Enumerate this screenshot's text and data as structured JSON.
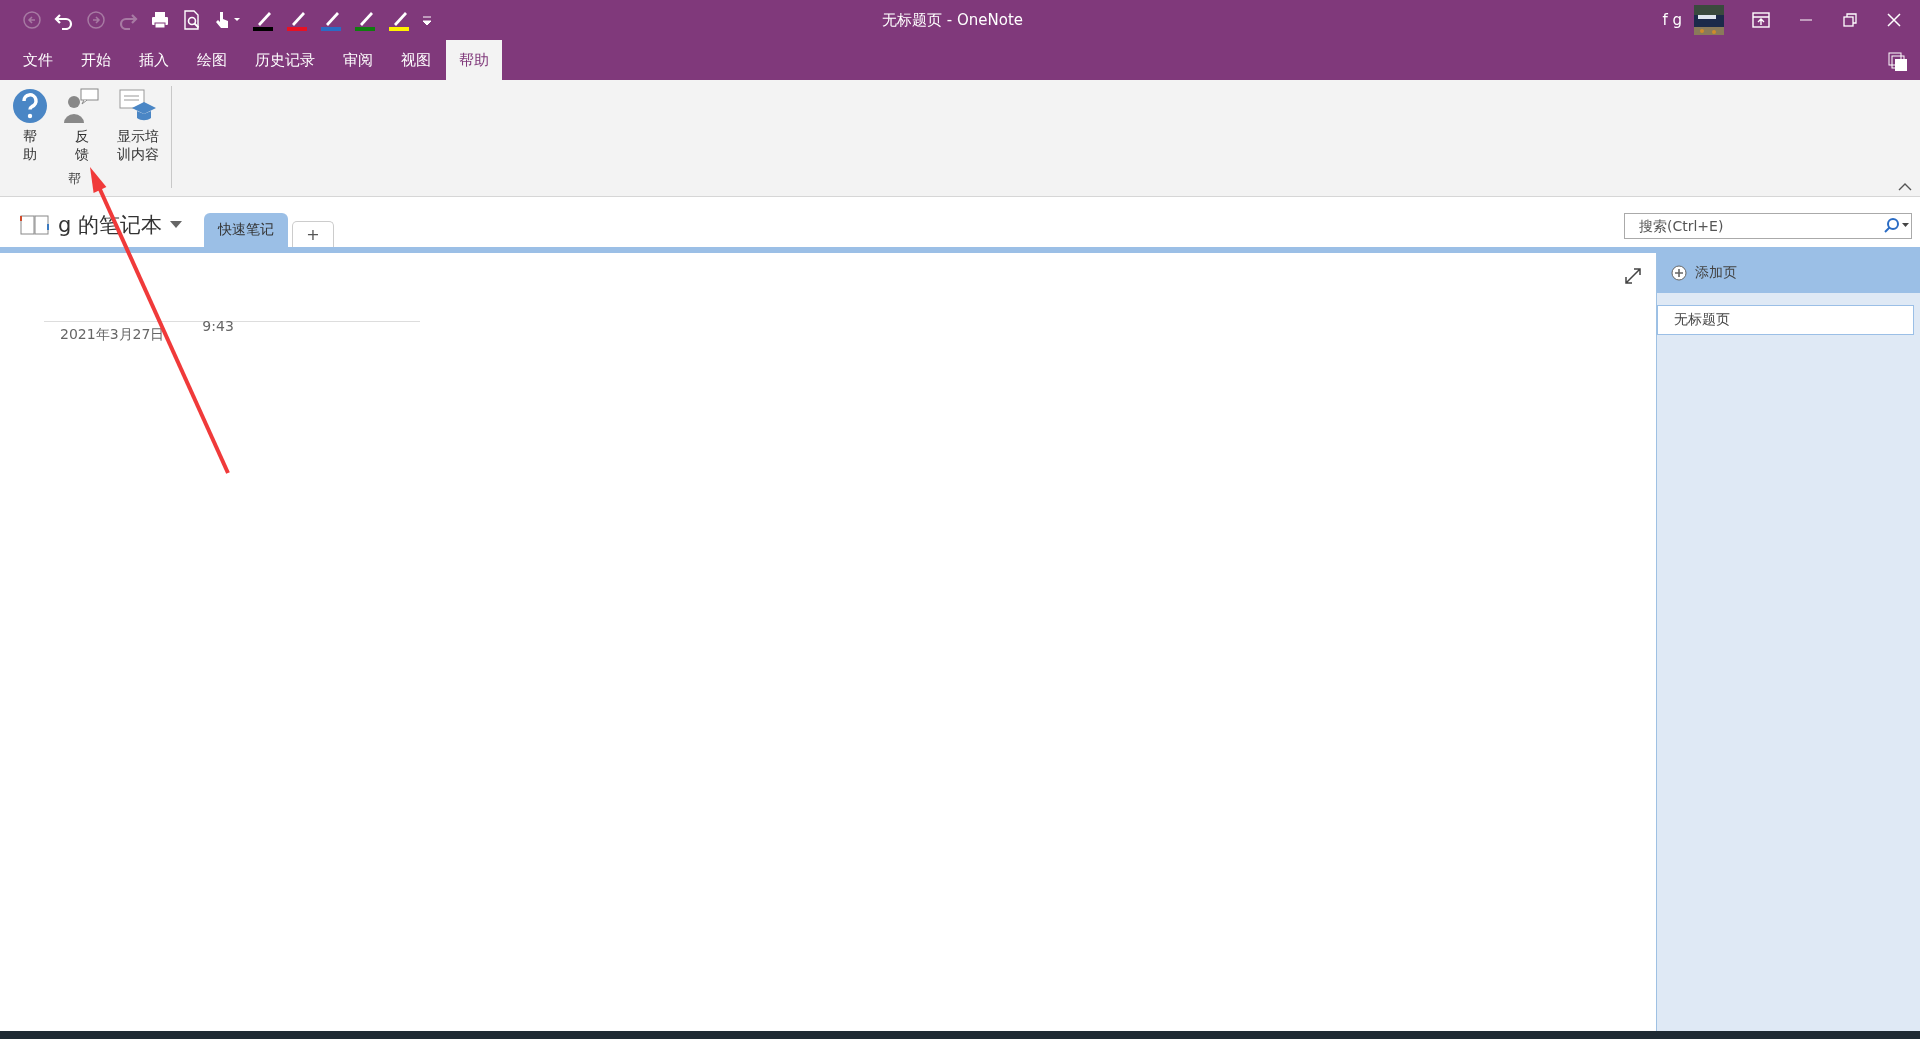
{
  "window": {
    "title": "无标题页 - OneNote",
    "user": "f g"
  },
  "quick_access": {
    "pens": [
      {
        "color": "#000000"
      },
      {
        "color": "#e81123"
      },
      {
        "color": "#2b6cc4"
      },
      {
        "color": "#107c10"
      },
      {
        "color": "#fff100"
      }
    ]
  },
  "menu_tabs": [
    {
      "label": "文件",
      "selected": false
    },
    {
      "label": "开始",
      "selected": false
    },
    {
      "label": "插入",
      "selected": false
    },
    {
      "label": "绘图",
      "selected": false
    },
    {
      "label": "历史记录",
      "selected": false
    },
    {
      "label": "审阅",
      "selected": false
    },
    {
      "label": "视图",
      "selected": false
    },
    {
      "label": "帮助",
      "selected": true
    }
  ],
  "ribbon": {
    "group_label": "帮",
    "buttons": [
      {
        "kind": "help",
        "label": "帮助"
      },
      {
        "kind": "feedback",
        "label": "反馈"
      },
      {
        "kind": "training",
        "label": "显示培训内容"
      }
    ]
  },
  "notebook": {
    "name": "g 的笔记本",
    "sections": [
      {
        "label": "快速笔记",
        "selected": true
      }
    ],
    "add_section": "+"
  },
  "search": {
    "placeholder": "搜索(Ctrl+E)"
  },
  "page": {
    "date": "2021年3月27日",
    "time": "9:43"
  },
  "pages_pane": {
    "add_page": "添加页",
    "pages": [
      {
        "title": "无标题页",
        "selected": true
      }
    ]
  }
}
